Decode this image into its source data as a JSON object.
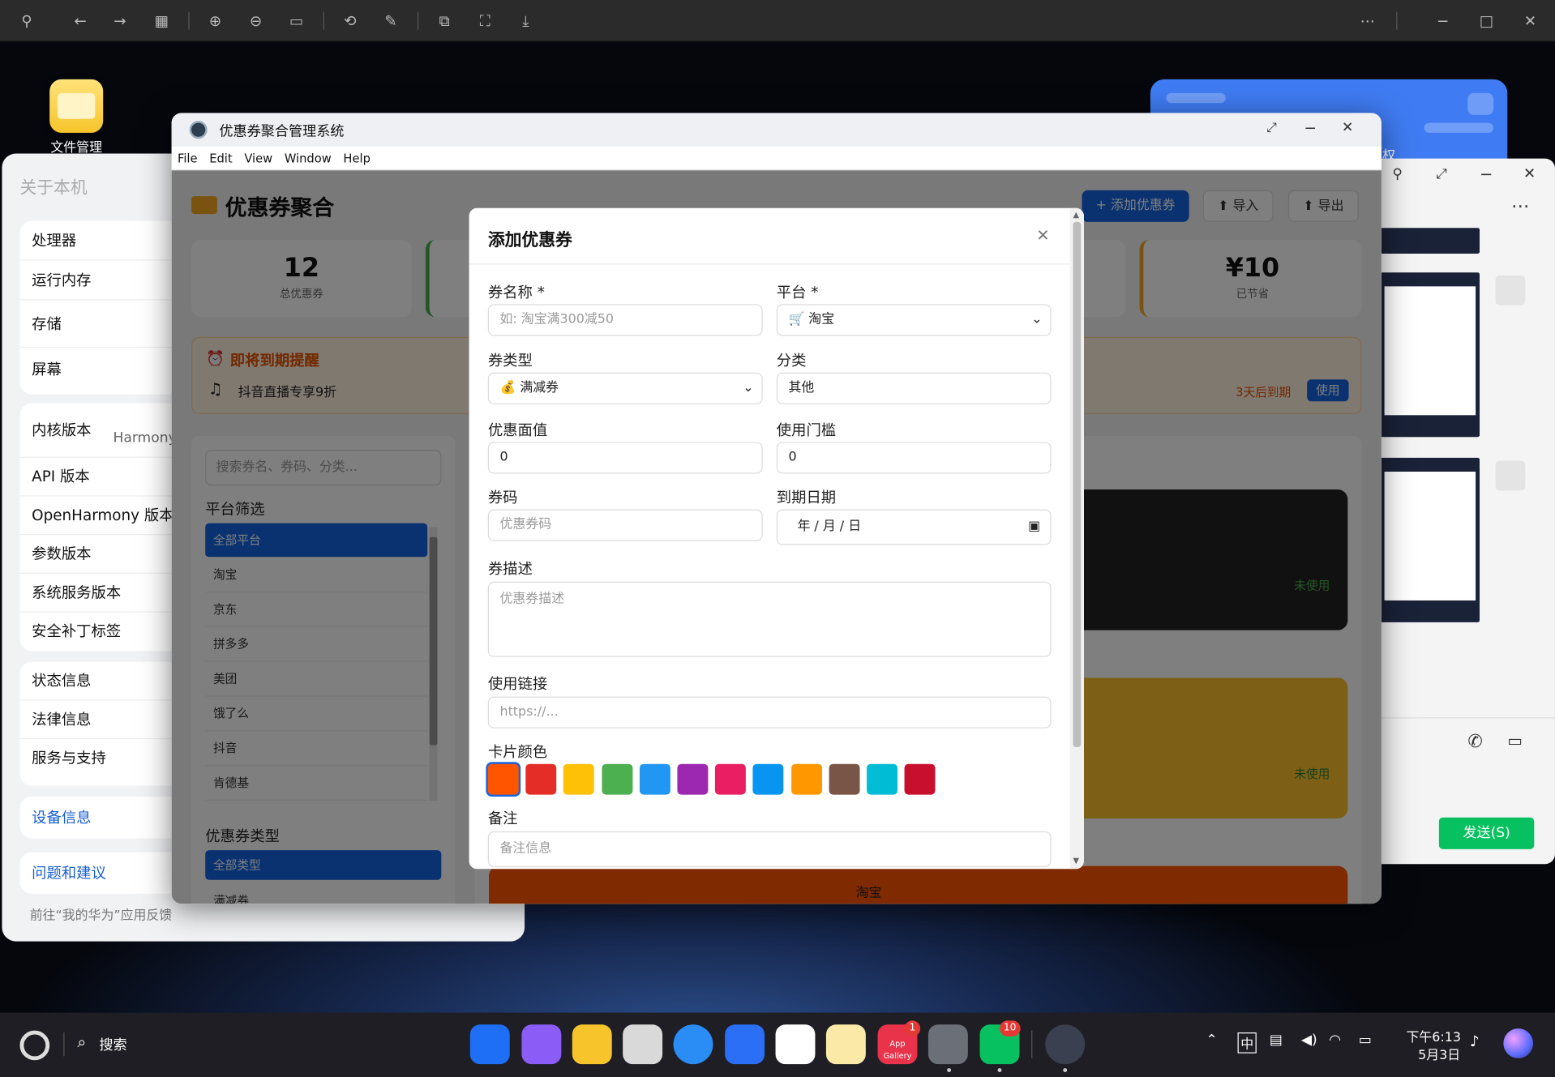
{
  "viewer_toolbar": {
    "icons": [
      "pin-icon",
      "back-icon",
      "forward-icon",
      "grid-icon",
      "zoom-in-icon",
      "zoom-out-icon",
      "fit-icon",
      "rotate-icon",
      "edit-icon",
      "translate-icon",
      "scan-icon",
      "download-icon",
      "more-icon",
      "minimize-icon",
      "maximize-icon",
      "close-icon"
    ]
  },
  "desktop": {
    "file_icon_label": "文件管理"
  },
  "about_panel": {
    "title": "关于本机",
    "group1": [
      "处理器",
      "运行内存",
      "存储",
      "屏幕"
    ],
    "group2": [
      "内核版本",
      "API 版本",
      "OpenHarmony 版本",
      "参数版本",
      "系统服务版本",
      "安全补丁标签"
    ],
    "kernel_value_partial": "Harmony(",
    "group3": [
      "状态信息",
      "法律信息",
      "服务与支持"
    ],
    "device_info": "设备信息",
    "feedback": "问题和建议",
    "feedback_hint": "前往“我的华为”应用反馈"
  },
  "right_window": {
    "partial_text": "权",
    "send_label": "发送(S)"
  },
  "app": {
    "window_title": "优惠券聚合管理系统",
    "menu": [
      "File",
      "Edit",
      "View",
      "Window",
      "Help"
    ],
    "header_title": "优惠券聚合",
    "add_button": "+ 添加优惠券",
    "import_button": "导入",
    "export_button": "导出",
    "stats": [
      {
        "value": "12",
        "label": "总优惠券"
      },
      {
        "value": "¥10",
        "label": "已节省"
      }
    ],
    "expiry": {
      "title": "即将到期提醒",
      "item": "抖音直播专享9折",
      "days": "3天后到期",
      "use_button": "使用"
    },
    "search_placeholder": "搜索券名、券码、分类...",
    "platform_filter_title": "平台筛选",
    "platforms": [
      "全部平台",
      "淘宝",
      "京东",
      "拼多多",
      "美团",
      "饿了么",
      "抖音",
      "肯德基"
    ],
    "type_filter_title": "优惠券类型",
    "types": [
      "全部类型",
      "满减券"
    ],
    "card_status_1": "未使用",
    "card_status_2": "未使用",
    "card_platform_3": "淘宝"
  },
  "modal": {
    "title": "添加优惠券",
    "name_label": "券名称 *",
    "name_placeholder": "如: 淘宝满300减50",
    "platform_label": "平台 *",
    "platform_value": "淘宝",
    "type_label": "券类型",
    "type_value": "满减券",
    "category_label": "分类",
    "category_value": "其他",
    "value_label": "优惠面值",
    "value_value": "0",
    "threshold_label": "使用门槛",
    "threshold_value": "0",
    "code_label": "券码",
    "code_placeholder": "优惠券码",
    "expiry_label": "到期日期",
    "expiry_value": "年 / 月 / 日",
    "desc_label": "券描述",
    "desc_placeholder": "优惠券描述",
    "link_label": "使用链接",
    "link_placeholder": "https://...",
    "color_label": "卡片颜色",
    "colors": [
      "#ff5500",
      "#e52d27",
      "#ffc107",
      "#4caf50",
      "#2196f3",
      "#9c27b0",
      "#e91e63",
      "#0895f2",
      "#ff9800",
      "#795548",
      "#00bcd4",
      "#c8102e"
    ],
    "note_label": "备注",
    "note_placeholder": "备注信息"
  },
  "taskbar": {
    "search_label": "搜索",
    "app_gallery_label": "App Gallery",
    "gallery_badge": "1",
    "wechat_badge": "10",
    "ime": "中",
    "time": "下午6:13",
    "date": "5月3日"
  }
}
